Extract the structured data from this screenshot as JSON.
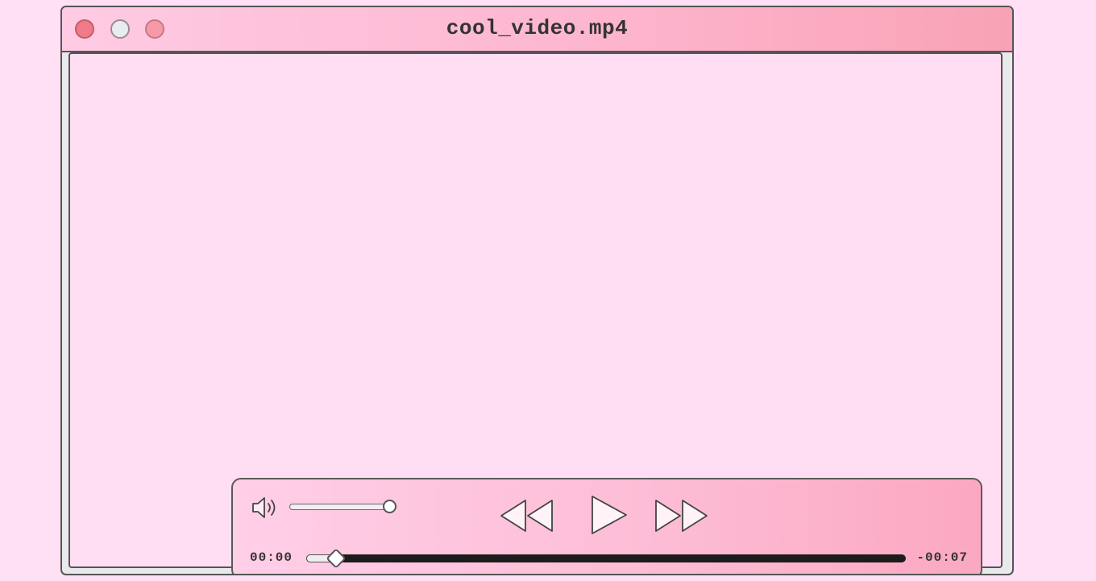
{
  "window": {
    "title": "cool_video.mp4"
  },
  "player": {
    "volume_level": 1.0,
    "elapsed": "00:00",
    "remaining": "-00:07",
    "progress": 0.05
  },
  "icons": {
    "close": "close-window-icon",
    "minimize": "minimize-window-icon",
    "maximize": "maximize-window-icon",
    "volume": "speaker-icon",
    "rewind": "rewind-icon",
    "play": "play-icon",
    "fast_forward": "fast-forward-icon"
  },
  "colors": {
    "background": "#ffe0f4",
    "video_area": "#ffdef3",
    "close": "#ef7b88",
    "minimize": "#e8ecef",
    "maximize": "#f79aa8"
  }
}
